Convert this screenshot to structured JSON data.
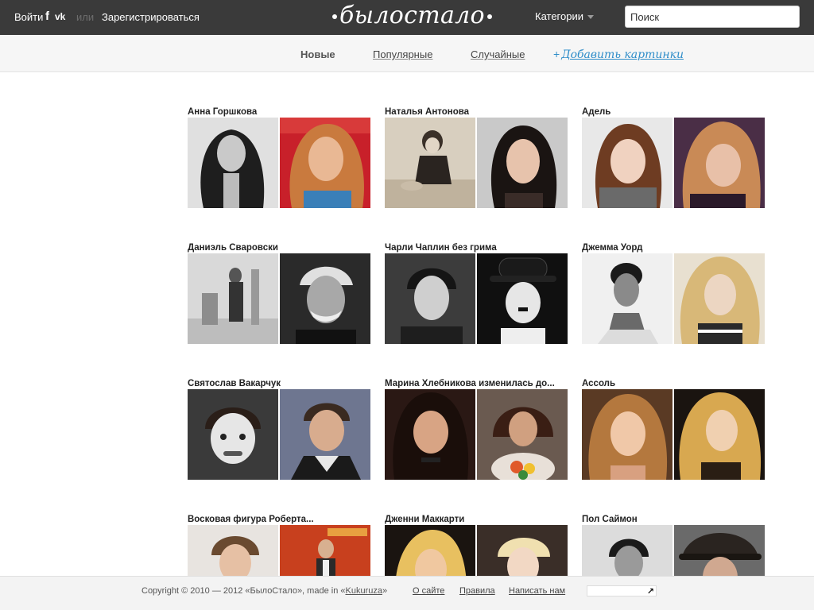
{
  "header": {
    "login": "Войти",
    "facebook": "f",
    "vk": "vk",
    "or": "или",
    "register": "Зарегистрироваться",
    "logo": "былостало",
    "categories": "Категории",
    "search_placeholder": "Поиск"
  },
  "nav": {
    "tabs": [
      {
        "label": "Новые",
        "active": true
      },
      {
        "label": "Популярные",
        "active": false
      },
      {
        "label": "Случайные",
        "active": false
      }
    ],
    "add_plus": "+",
    "add_label": "Добавить картинки"
  },
  "cards": [
    {
      "title": "Анна Горшкова"
    },
    {
      "title": "Наталья Антонова"
    },
    {
      "title": "Адель"
    },
    {
      "title": "Даниэль Сваровски"
    },
    {
      "title": "Чарли Чаплин без грима"
    },
    {
      "title": "Джемма Уорд"
    },
    {
      "title": "Святослав Вакарчук"
    },
    {
      "title": "Марина Хлебникова изменилась до..."
    },
    {
      "title": "Ассоль"
    },
    {
      "title": "Восковая фигура Роберта..."
    },
    {
      "title": "Дженни Маккарти"
    },
    {
      "title": "Пол Саймон"
    }
  ],
  "footer": {
    "copyright": "Copyright © 2010 — 2012 «БылоСтало», made in «",
    "kukuruza": "Kukuruza",
    "copyright_end": "»",
    "about": "О сайте",
    "rules": "Правила",
    "contact": "Написать нам",
    "counter_arrow": "↗"
  },
  "colors": {
    "topbar": "#3a3a3a",
    "subnav": "#f6f6f6",
    "link": "#2f8dc9"
  }
}
